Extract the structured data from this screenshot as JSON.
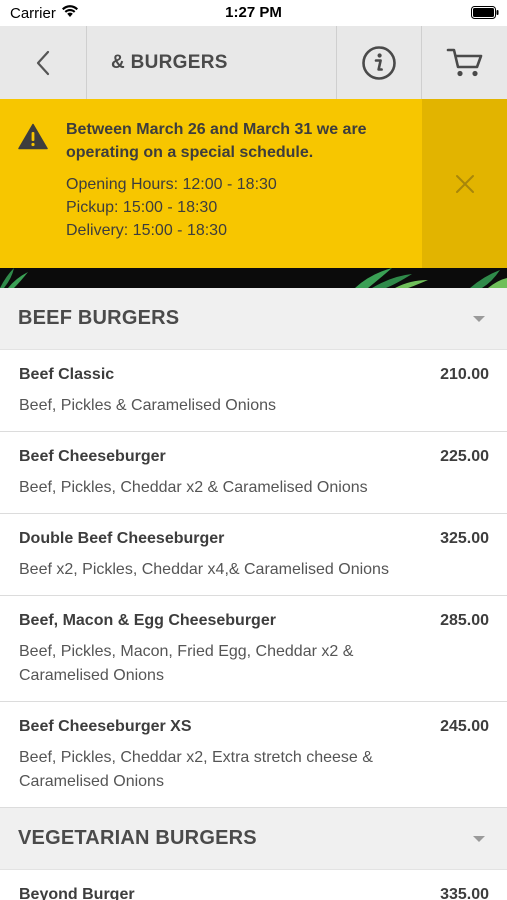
{
  "status_bar": {
    "carrier": "Carrier",
    "time": "1:27 PM"
  },
  "nav": {
    "title": "& BURGERS"
  },
  "notice": {
    "headline": "Between March 26 and March 31 we are operating on a special schedule.",
    "lines": [
      "Opening Hours: 12:00 - 18:30",
      "Pickup: 15:00 - 18:30",
      "Delivery: 15:00 - 18:30"
    ]
  },
  "categories": [
    {
      "name": "BEEF BURGERS",
      "items": [
        {
          "name": "Beef Classic",
          "price": "210.00",
          "description": "Beef, Pickles & Caramelised Onions"
        },
        {
          "name": "Beef Cheeseburger",
          "price": "225.00",
          "description": "Beef, Pickles, Cheddar x2 & Caramelised Onions"
        },
        {
          "name": "Double Beef Cheeseburger",
          "price": "325.00",
          "description": "Beef x2, Pickles, Cheddar x4,& Caramelised Onions"
        },
        {
          "name": "Beef, Macon & Egg Cheeseburger",
          "price": "285.00",
          "description": "Beef, Pickles, Macon, Fried Egg, Cheddar x2 & Caramelised Onions"
        },
        {
          "name": "Beef Cheeseburger XS",
          "price": "245.00",
          "description": "Beef, Pickles, Cheddar x2, Extra stretch cheese & Caramelised Onions"
        }
      ]
    },
    {
      "name": "VEGETARIAN BURGERS",
      "items": [
        {
          "name": "Beyond Burger",
          "price": "335.00",
          "description": ""
        }
      ]
    }
  ],
  "colors": {
    "notice_bg": "#f7c600",
    "notice_close_bg": "#e2b400",
    "nav_bg": "#e8e8e8",
    "category_bg": "#f0f0f0"
  }
}
